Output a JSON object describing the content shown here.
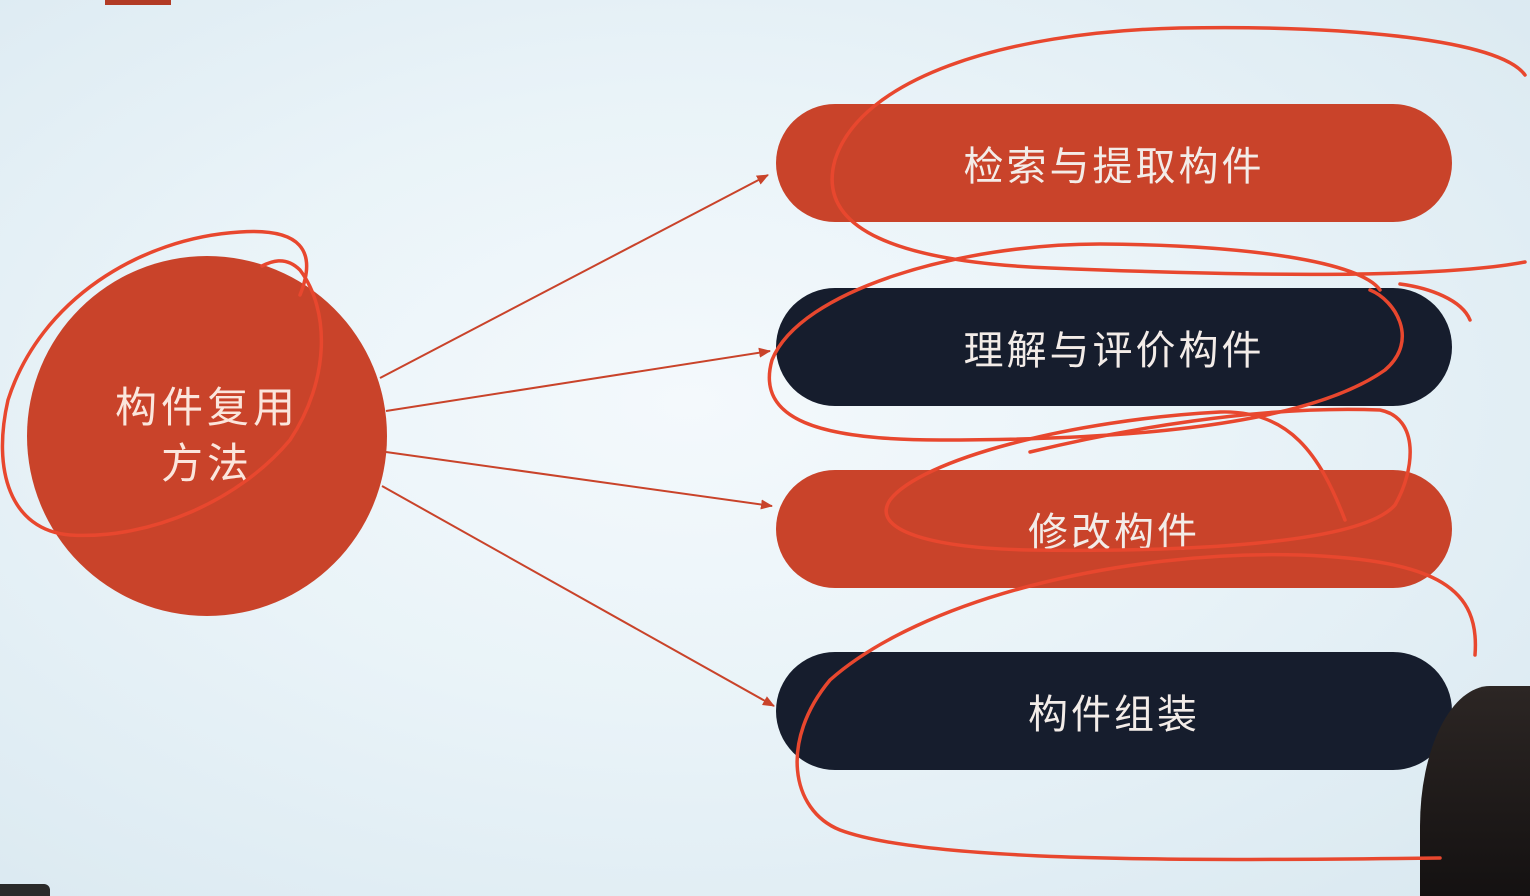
{
  "center": {
    "label": "构件复用方法"
  },
  "nodes": [
    {
      "label": "检索与提取构件",
      "color": "#c9432a"
    },
    {
      "label": "理解与评价构件",
      "color": "#161d2d"
    },
    {
      "label": "修改构件",
      "color": "#c9432a"
    },
    {
      "label": "构件组装",
      "color": "#161d2d"
    }
  ],
  "colors": {
    "accent": "#c9432a",
    "dark": "#161d2d",
    "annotation": "#e8472e"
  }
}
